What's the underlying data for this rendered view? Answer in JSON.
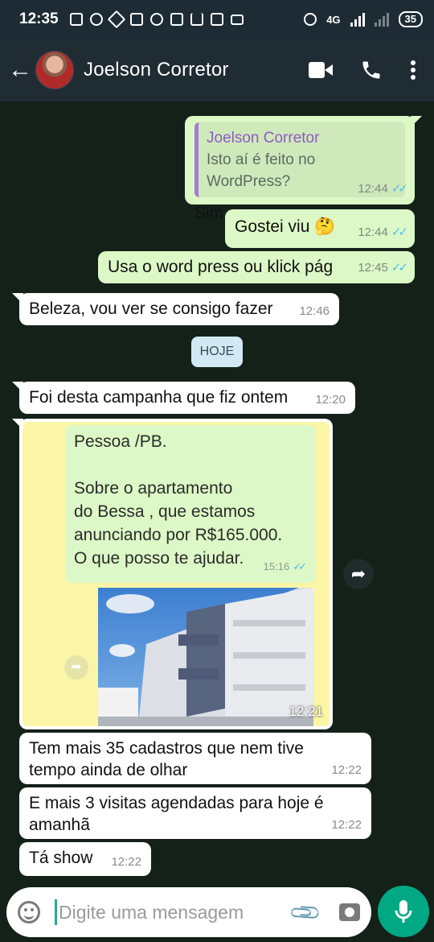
{
  "status_bar": {
    "time": "12:35",
    "network": "4G",
    "battery": "35"
  },
  "header": {
    "contact_name": "Joelson Corretor"
  },
  "messages": [
    {
      "quoted_name": "Joelson Corretor",
      "quoted_text": "Isto aí é feito no WordPress?",
      "text": "Sim sim",
      "time": "12:44",
      "ticks": "✓✓"
    },
    {
      "text": "Gostei viu 🤔",
      "time": "12:44",
      "ticks": "✓✓"
    },
    {
      "text": "Usa o word press ou klick pág",
      "time": "12:45",
      "ticks": "✓✓"
    },
    {
      "text": "Beleza,  vou ver se consigo fazer",
      "time": "12:46"
    },
    {
      "text": "Foi desta campanha que fiz ontem",
      "time": "12:20"
    },
    {
      "image_inner_text": "Pessoa /PB.\n\nSobre o apartamento\ndo Bessa , que estamos\nanunciando por R$165.000.\nO que posso te ajudar.",
      "image_inner_time": "15:16",
      "image_inner_ticks": "✓✓",
      "time": "12:21"
    },
    {
      "text": "Tem mais 35 cadastros que nem tive tempo ainda de olhar",
      "time": "12:22"
    },
    {
      "text": "E mais 3 visitas agendadas para hoje é amanhã",
      "time": "12:22"
    },
    {
      "text": "Tá show",
      "time": "12:22"
    }
  ],
  "date_divider": "HOJE",
  "input": {
    "placeholder": "Digite uma mensagem"
  },
  "colors": {
    "header": "#1f2c34",
    "outgoing": "#dcf8c6",
    "incoming": "#ffffff",
    "accent": "#00a884",
    "ticks": "#53bdeb",
    "chat_bg": "#142119"
  }
}
